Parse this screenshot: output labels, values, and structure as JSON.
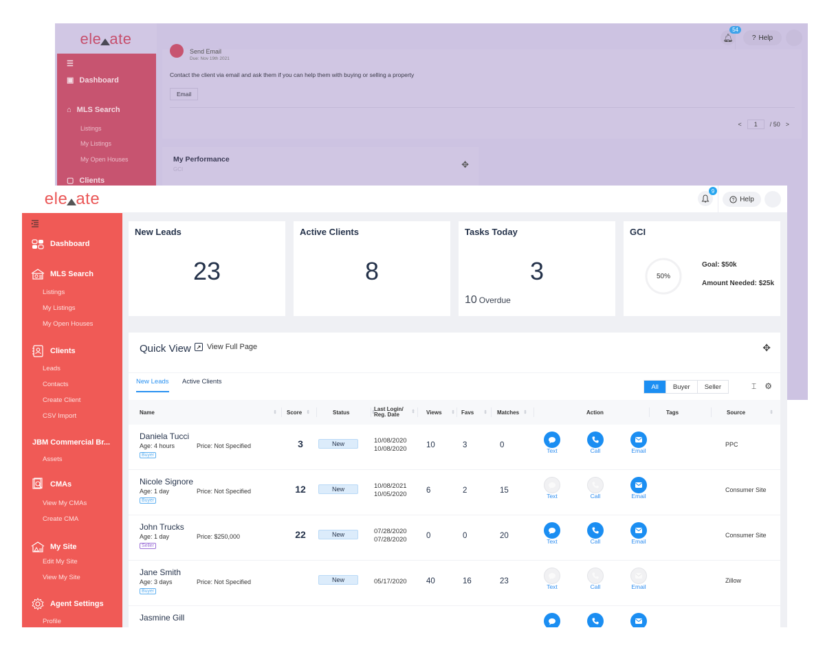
{
  "back_window": {
    "logo": {
      "pre": "ele",
      "post": "ate"
    },
    "nav": [
      {
        "label": "Dashboard"
      },
      {
        "label": "MLS Search"
      }
    ],
    "subnav": [
      "Listings",
      "My Listings",
      "My Open Houses"
    ],
    "partial_item": "Clients",
    "notification_count": "54",
    "help_label": "Help",
    "task": {
      "title": "Send Email",
      "due": "Due: Nov 19th 2021",
      "description": "Contact the client via email and ask them if you can help them with buying or selling a property",
      "button": "Email"
    },
    "pagination": {
      "prev": "<",
      "current": "1",
      "total": "/ 50",
      "next": ">"
    },
    "performance": {
      "title": "My Performance",
      "subtitle": "GCI"
    }
  },
  "header": {
    "logo": {
      "pre": "ele",
      "post": "ate"
    },
    "notification_count": "9",
    "help_label": "Help"
  },
  "sidebar": {
    "sections": [
      {
        "label": "Dashboard",
        "icon": "dashboard-icon"
      },
      {
        "label": "MLS Search",
        "icon": "house-search-icon",
        "items": [
          "Listings",
          "My Listings",
          "My Open Houses"
        ]
      },
      {
        "label": "Clients",
        "icon": "contact-card-icon",
        "items": [
          "Leads",
          "Contacts",
          "Create Client",
          "CSV Import"
        ]
      },
      {
        "label": "JBM Commercial Br...",
        "items": [
          "Assets"
        ]
      },
      {
        "label": "CMAs",
        "icon": "cma-icon",
        "items": [
          "View My CMAs",
          "Create CMA"
        ]
      },
      {
        "label": "My Site",
        "icon": "site-icon",
        "items": [
          "Edit My Site",
          "View My Site"
        ]
      },
      {
        "label": "Agent Settings",
        "icon": "gear-icon",
        "items": [
          "Profile"
        ]
      }
    ]
  },
  "cards": {
    "new_leads": {
      "title": "New Leads",
      "value": "23"
    },
    "active_clients": {
      "title": "Active Clients",
      "value": "8"
    },
    "tasks_today": {
      "title": "Tasks Today",
      "value": "3",
      "overdue_count": "10",
      "overdue_label": "Overdue"
    },
    "gci": {
      "title": "GCI",
      "percent_label": "50%",
      "progress": 0.5,
      "goal": "Goal: $50k",
      "amount_needed": "Amount Needed: $25k"
    }
  },
  "quick_view": {
    "title": "Quick View",
    "view_full_page": "View Full Page",
    "tabs": [
      {
        "label": "New Leads",
        "active": true
      },
      {
        "label": "Active Clients",
        "active": false
      }
    ],
    "filters": [
      {
        "label": "All",
        "active": true
      },
      {
        "label": "Buyer",
        "active": false
      },
      {
        "label": "Seller",
        "active": false
      }
    ],
    "columns": [
      "Name",
      "Score",
      "Status",
      "Last Login/\nReg. Date",
      "Views",
      "Favs",
      "Matches",
      "Action",
      "Tags",
      "Source"
    ],
    "action_labels": {
      "text": "Text",
      "call": "Call",
      "email": "Email"
    },
    "rows": [
      {
        "name": "Daniela Tucci",
        "age": "Age: 4 hours",
        "price": "Price: Not Specified",
        "type": "Buyer",
        "score": "3",
        "status": "New",
        "last_login": "10/08/2020",
        "reg_date": "10/08/2020",
        "views": "10",
        "favs": "3",
        "matches": "0",
        "text": true,
        "call": true,
        "email": true,
        "tags": "",
        "source": "PPC"
      },
      {
        "name": "Nicole Signore",
        "age": "Age: 1 day",
        "price": "Price: Not Specified",
        "type": "Buyer",
        "score": "12",
        "status": "New",
        "last_login": "10/08/2021",
        "reg_date": "10/05/2020",
        "views": "6",
        "favs": "2",
        "matches": "15",
        "text": false,
        "call": false,
        "email": true,
        "tags": "",
        "source": "Consumer Site"
      },
      {
        "name": "John Trucks",
        "age": "Age: 1 day",
        "price": "Price: $250,000",
        "type": "Seller",
        "score": "22",
        "status": "New",
        "last_login": "07/28/2020",
        "reg_date": "07/28/2020",
        "views": "0",
        "favs": "0",
        "matches": "20",
        "text": true,
        "call": true,
        "email": true,
        "tags": "",
        "source": "Consumer Site"
      },
      {
        "name": "Jane Smith",
        "age": "Age: 3 days",
        "price": "Price: Not Specified",
        "type": "Buyer",
        "score": "",
        "status": "New",
        "last_login": "05/17/2020",
        "reg_date": "",
        "views": "40",
        "favs": "16",
        "matches": "23",
        "text": false,
        "call": false,
        "email": false,
        "tags": "",
        "source": "Zillow"
      },
      {
        "name": "Jasmine Gill",
        "age": "",
        "price": "",
        "type": "",
        "score": "",
        "status": "",
        "last_login": "",
        "reg_date": "",
        "views": "",
        "favs": "",
        "matches": "",
        "text": true,
        "call": true,
        "email": true,
        "tags": "",
        "source": ""
      }
    ]
  },
  "colors": {
    "brand_red": "#f05a56",
    "accent_blue": "#1b8ef2",
    "buyer_tag": "#5aaef0",
    "seller_tag": "#9b6fd6",
    "overlay_purple": "#cdc3e2"
  }
}
